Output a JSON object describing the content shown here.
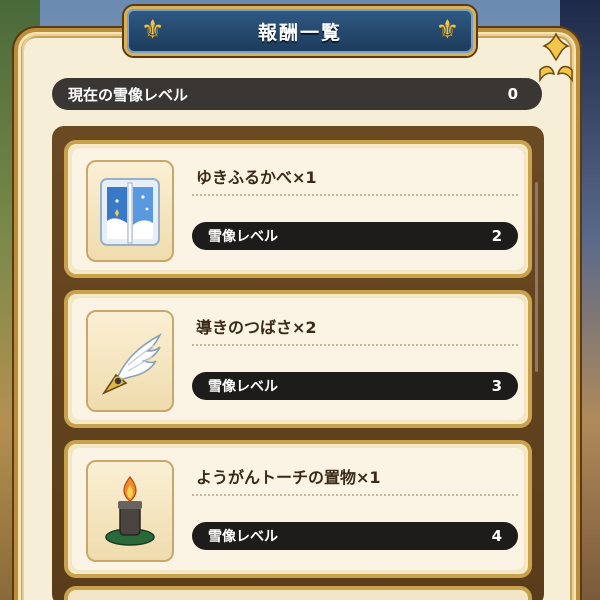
{
  "title": "報酬一覧",
  "current_level": {
    "label": "現在の雪像レベル",
    "value": "0"
  },
  "rewards": [
    {
      "name": "ゆきふるかべ×1",
      "icon": "snowy-wall-icon",
      "req_label": "雪像レベル",
      "req_value": "2"
    },
    {
      "name": "導きのつばさ×2",
      "icon": "guiding-wing-icon",
      "req_label": "雪像レベル",
      "req_value": "3"
    },
    {
      "name": "ようがんトーチの置物×1",
      "icon": "lava-torch-figurine-icon",
      "req_label": "雪像レベル",
      "req_value": "4"
    }
  ],
  "colors": {
    "banner": "#1c3a5a",
    "gold_frame": "#c9a24e",
    "dark_pill": "#1e1c1a",
    "card_bg": "#fbf4e4"
  }
}
